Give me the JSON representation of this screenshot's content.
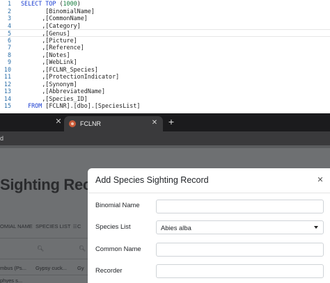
{
  "editor": {
    "lines": [
      {
        "n": "1",
        "parts": [
          {
            "t": "SELECT TOP ",
            "c": "kw"
          },
          {
            "t": "(",
            "c": "col"
          },
          {
            "t": "1000",
            "c": "num"
          },
          {
            "t": ")",
            "c": "col"
          }
        ]
      },
      {
        "n": "2",
        "parts": [
          {
            "t": "       [BinomialName]",
            "c": "col"
          }
        ]
      },
      {
        "n": "3",
        "parts": [
          {
            "t": "      ,[CommonName]",
            "c": "col"
          }
        ]
      },
      {
        "n": "4",
        "parts": [
          {
            "t": "      ,[Category]",
            "c": "col"
          }
        ]
      },
      {
        "n": "5",
        "parts": [
          {
            "t": "      ,[Genus]",
            "c": "col"
          }
        ]
      },
      {
        "n": "6",
        "parts": [
          {
            "t": "      ,[Picture]",
            "c": "col"
          }
        ]
      },
      {
        "n": "7",
        "parts": [
          {
            "t": "      ,[Reference]",
            "c": "col"
          }
        ]
      },
      {
        "n": "8",
        "parts": [
          {
            "t": "      ,[Notes]",
            "c": "col"
          }
        ]
      },
      {
        "n": "9",
        "parts": [
          {
            "t": "      ,[WebLink]",
            "c": "col"
          }
        ]
      },
      {
        "n": "10",
        "parts": [
          {
            "t": "      ,[FCLNR_Species]",
            "c": "col"
          }
        ]
      },
      {
        "n": "11",
        "parts": [
          {
            "t": "      ,[ProtectionIndicator]",
            "c": "col"
          }
        ]
      },
      {
        "n": "12",
        "parts": [
          {
            "t": "      ,[Synonym]",
            "c": "col"
          }
        ]
      },
      {
        "n": "13",
        "parts": [
          {
            "t": "      ,[AbbreviatedName]",
            "c": "col"
          }
        ]
      },
      {
        "n": "14",
        "parts": [
          {
            "t": "      ,[Species_ID]",
            "c": "col"
          }
        ]
      },
      {
        "n": "15",
        "parts": [
          {
            "t": "  FROM ",
            "c": "kw"
          },
          {
            "t": "[FCLNR].[dbo].[SpeciesList]",
            "c": "col"
          }
        ]
      }
    ],
    "current_line": 5
  },
  "browser": {
    "tab_title": "FCLNR",
    "tab_close_glyph": "✕",
    "newtab_glyph": "+",
    "toolbar_text": "d"
  },
  "app": {
    "page_title": "Sighting Record",
    "grid_headers": [
      {
        "label": "OMIAL NAME"
      },
      {
        "label": "SPECIES LIST"
      },
      {
        "label": "C"
      }
    ],
    "grid_rows": [
      [
        "mbus (Ps...",
        "Gypsy cuck...",
        "Gy"
      ],
      [
        "phyes s..."
      ]
    ]
  },
  "modal": {
    "title": "Add Species Sighting Record",
    "fields": {
      "binomial_name": {
        "label": "Binomial Name",
        "value": ""
      },
      "species_list": {
        "label": "Species List",
        "value": "Abies alba"
      },
      "common_name": {
        "label": "Common Name",
        "value": ""
      },
      "recorder": {
        "label": "Recorder",
        "value": ""
      }
    }
  }
}
